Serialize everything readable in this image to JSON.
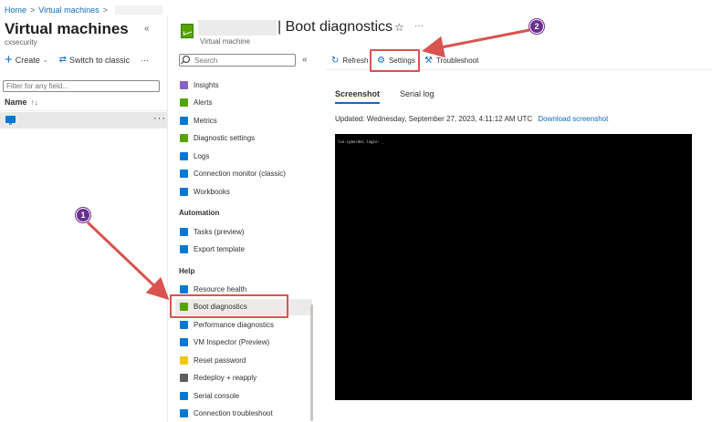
{
  "breadcrumb": {
    "home": "Home",
    "vms": "Virtual machines",
    "sep": ">"
  },
  "left_blade": {
    "title": "Virtual machines",
    "subtitle": "cxsecurity",
    "create_label": "Create",
    "switch_label": "Switch to classic",
    "more_label": "···",
    "filter_placeholder": "Filter for any field...",
    "column_name": "Name",
    "sort_indicator": "↑↓",
    "collapse": "«",
    "row_more": "···"
  },
  "resource": {
    "title": "| Boot diagnostics",
    "subtitle": "Virtual machine",
    "star": "☆",
    "ellipsis": "···"
  },
  "menu": {
    "search_placeholder": "Search",
    "collapse": "«",
    "items_top": [
      {
        "label": "Insights",
        "color": "#8661c5"
      },
      {
        "label": "Alerts",
        "color": "#57a300"
      },
      {
        "label": "Metrics",
        "color": "#0078d4"
      },
      {
        "label": "Diagnostic settings",
        "color": "#57a300"
      },
      {
        "label": "Logs",
        "color": "#0078d4"
      },
      {
        "label": "Connection monitor (classic)",
        "color": "#0078d4"
      },
      {
        "label": "Workbooks",
        "color": "#0078d4"
      }
    ],
    "automation_header": "Automation",
    "items_automation": [
      {
        "label": "Tasks (preview)",
        "color": "#0078d4"
      },
      {
        "label": "Export template",
        "color": "#0078d4"
      }
    ],
    "help_header": "Help",
    "items_help": [
      {
        "label": "Resource health",
        "color": "#0078d4"
      },
      {
        "label": "Boot diagnostics",
        "color": "#57a300"
      },
      {
        "label": "Performance diagnostics",
        "color": "#0078d4"
      },
      {
        "label": "VM Inspector (Preview)",
        "color": "#0078d4"
      },
      {
        "label": "Reset password",
        "color": "#f2c811"
      },
      {
        "label": "Redeploy + reapply",
        "color": "#605e5c"
      },
      {
        "label": "Serial console",
        "color": "#0078d4"
      },
      {
        "label": "Connection troubleshoot",
        "color": "#0078d4"
      }
    ]
  },
  "toolbar": {
    "refresh": "Refresh",
    "settings": "Settings",
    "troubleshoot": "Troubleshoot"
  },
  "tabs": {
    "screenshot": "Screenshot",
    "serial_log": "Serial log"
  },
  "updated_text": "Updated: Wednesday, September 27, 2023, 4:11:12 AM UTC",
  "download_link": "Download screenshot",
  "console_text": "lse-cyberdec login: _",
  "annotations": {
    "one": "1",
    "two": "2",
    "color": "#d9534f"
  }
}
